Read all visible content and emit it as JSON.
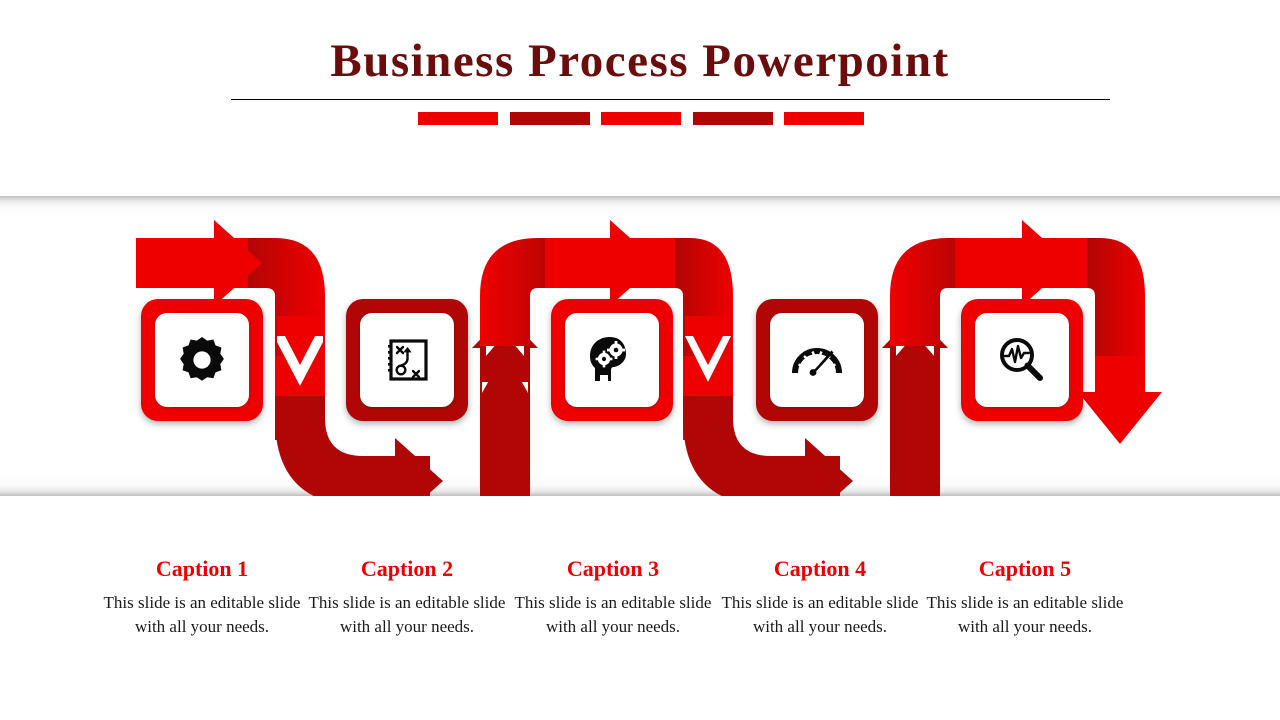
{
  "slide": {
    "title": "Business Process Powerpoint",
    "title_color": "#6b0d0d",
    "accent_bright": "#ee0000",
    "accent_dark": "#b00606",
    "background": "#ffffff"
  },
  "accent_bars": [
    {
      "name": "accent-bar-1",
      "color": "#ee0000"
    },
    {
      "name": "accent-bar-2",
      "color": "#b00606"
    },
    {
      "name": "accent-bar-3",
      "color": "#ee0000"
    },
    {
      "name": "accent-bar-4",
      "color": "#b00606"
    },
    {
      "name": "accent-bar-5",
      "color": "#ee0000"
    }
  ],
  "steps": [
    {
      "index": 1,
      "icon": "gear-icon",
      "tile_color": "#ee0000",
      "caption_title": "Caption 1",
      "caption_body": "This slide is an editable slide with all your needs."
    },
    {
      "index": 2,
      "icon": "strategy-playbook-icon",
      "tile_color": "#b00606",
      "caption_title": "Caption 2",
      "caption_body": "This slide is an editable slide with all your needs."
    },
    {
      "index": 3,
      "icon": "head-with-gears-icon",
      "tile_color": "#ee0000",
      "caption_title": "Caption 3",
      "caption_body": "This slide is an editable slide with all your needs."
    },
    {
      "index": 4,
      "icon": "speedometer-icon",
      "tile_color": "#b00606",
      "caption_title": "Caption 4",
      "caption_body": "This slide is an editable slide with all your needs."
    },
    {
      "index": 5,
      "icon": "magnifier-analytics-icon",
      "tile_color": "#ee0000",
      "caption_title": "Caption 5",
      "caption_body": "This slide is an editable slide with all your needs."
    }
  ],
  "flow": {
    "description": "Five-step serpentine process ribbon with alternating bright and dark red segments",
    "arrow_directions": [
      "right",
      "down",
      "right",
      "up",
      "right",
      "down",
      "right",
      "up",
      "right",
      "down"
    ]
  }
}
